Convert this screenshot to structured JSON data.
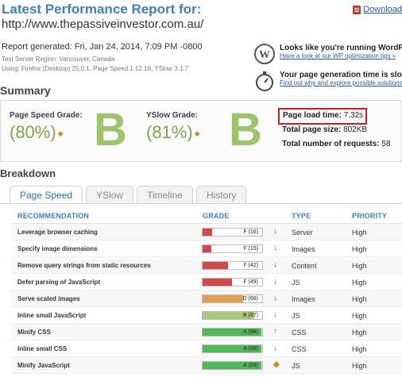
{
  "header": {
    "title": "Latest Performance Report for:",
    "url": "http://www.thepassiveinvestor.com.au/",
    "download_label": "Download"
  },
  "meta": {
    "generated": "Report generated: Fri, Jan 24, 2014, 7:09 PM -0800",
    "region": "Test Server Region: Vancouver, Canada",
    "using": "Using: Firefox (Desktop) 25.0.1, Page Speed 1.12.16, YSlow 3.1.7"
  },
  "notices": {
    "wordpress": {
      "title": "Looks like you're running WordPress",
      "link": "Have a look at our WP optimization tips »"
    },
    "timer": {
      "title": "Your page generation time is slow",
      "link": "Find out why and explore possible solutions"
    }
  },
  "summary": {
    "heading": "Summary",
    "pagespeed": {
      "label": "Page Speed Grade:",
      "percent": "(80%)",
      "letter": "B",
      "trend": "◆"
    },
    "yslow": {
      "label": "YSlow Grade:",
      "percent": "(81%)",
      "letter": "B",
      "trend": "◆"
    },
    "load_time_label": "Page load time:",
    "load_time_value": "7.32s",
    "size_label": "Total page size:",
    "size_value": "802KB",
    "requests_label": "Total number of requests:",
    "requests_value": "58"
  },
  "breakdown": {
    "heading": "Breakdown",
    "tabs": [
      "Page Speed",
      "YSlow",
      "Timeline",
      "History"
    ],
    "columns": {
      "recommendation": "RECOMMENDATION",
      "grade": "GRADE",
      "type": "TYPE",
      "priority": "PRIORITY"
    },
    "rows": [
      {
        "recommendation": "Leverage browser caching",
        "grade": "F (16)",
        "score": 16,
        "color": "#d04a4a",
        "arrow": "↓",
        "arrow_color": "#c0392b",
        "type": "Server",
        "priority": "High"
      },
      {
        "recommendation": "Specify image dimensions",
        "grade": "F (15)",
        "score": 15,
        "color": "#d04a4a",
        "arrow": "↓",
        "arrow_color": "#c0392b",
        "type": "Images",
        "priority": "High"
      },
      {
        "recommendation": "Remove query strings from static resources",
        "grade": "F (42)",
        "score": 42,
        "color": "#d04a4a",
        "arrow": "↓",
        "arrow_color": "#c0392b",
        "type": "Content",
        "priority": "High"
      },
      {
        "recommendation": "Defer parsing of JavaScript",
        "grade": "F (49)",
        "score": 49,
        "color": "#d04a4a",
        "arrow": "↓",
        "arrow_color": "#c0392b",
        "type": "JS",
        "priority": "High"
      },
      {
        "recommendation": "Serve scaled images",
        "grade": "D (68)",
        "score": 68,
        "color": "#e2a055",
        "arrow": "↓",
        "arrow_color": "#c0392b",
        "type": "Images",
        "priority": "High"
      },
      {
        "recommendation": "Inline small JavaScript",
        "grade": "B (87)",
        "score": 87,
        "color": "#a9c97a",
        "arrow": "↓",
        "arrow_color": "#c0392b",
        "type": "JS",
        "priority": "High"
      },
      {
        "recommendation": "Minify CSS",
        "grade": "A (98)",
        "score": 98,
        "color": "#4fb957",
        "arrow": "↑",
        "arrow_color": "#4a9a3a",
        "type": "CSS",
        "priority": "High"
      },
      {
        "recommendation": "Inline small CSS",
        "grade": "A (98)",
        "score": 98,
        "color": "#4fb957",
        "arrow": "↓",
        "arrow_color": "#c0392b",
        "type": "CSS",
        "priority": "High"
      },
      {
        "recommendation": "Minify JavaScript",
        "grade": "A (99)",
        "score": 99,
        "color": "#4fb957",
        "arrow": "◆",
        "arrow_color": "#d08a20",
        "type": "JS",
        "priority": "High"
      }
    ]
  }
}
